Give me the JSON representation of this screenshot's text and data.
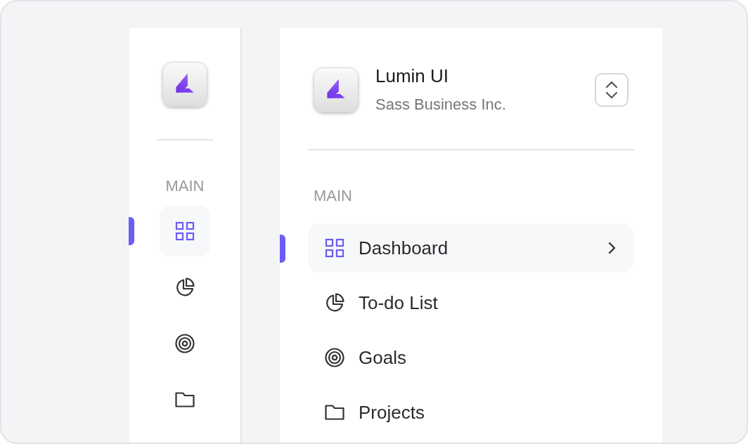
{
  "rail": {
    "section_label": "MAIN",
    "items": [
      {
        "kind": "grid",
        "selected": true
      },
      {
        "kind": "pie",
        "selected": false
      },
      {
        "kind": "target",
        "selected": false
      },
      {
        "kind": "folder",
        "selected": false
      }
    ]
  },
  "panel": {
    "title": "Lumin UI",
    "subtitle": "Sass Business Inc.",
    "section_label": "MAIN",
    "items": [
      {
        "kind": "grid",
        "label": "Dashboard",
        "selected": true
      },
      {
        "kind": "pie",
        "label": "To-do List",
        "selected": false
      },
      {
        "kind": "target",
        "label": "Goals",
        "selected": false
      },
      {
        "kind": "folder",
        "label": "Projects",
        "selected": false
      }
    ]
  }
}
